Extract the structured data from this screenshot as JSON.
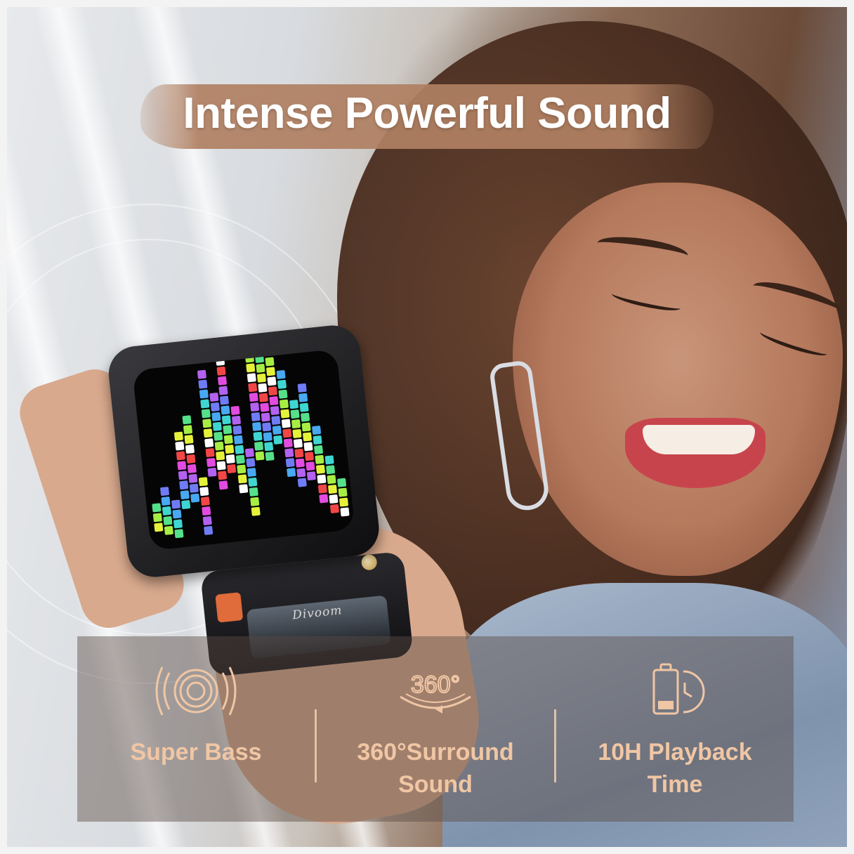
{
  "headline": "Intense Powerful Sound",
  "speaker": {
    "logo": "Divoom"
  },
  "features": [
    {
      "icon": "super-bass-icon",
      "label": "Super Bass"
    },
    {
      "icon": "360-surround-icon",
      "icon_text": "360°",
      "label_line1": "360°Surround",
      "label_line2": "Sound"
    },
    {
      "icon": "battery-clock-icon",
      "label_line1": "10H Playback",
      "label_line2": "Time"
    }
  ],
  "colors": {
    "accent": "#f0c6a4",
    "headline_stroke": "#b08062",
    "panel": "#5a4c44"
  }
}
